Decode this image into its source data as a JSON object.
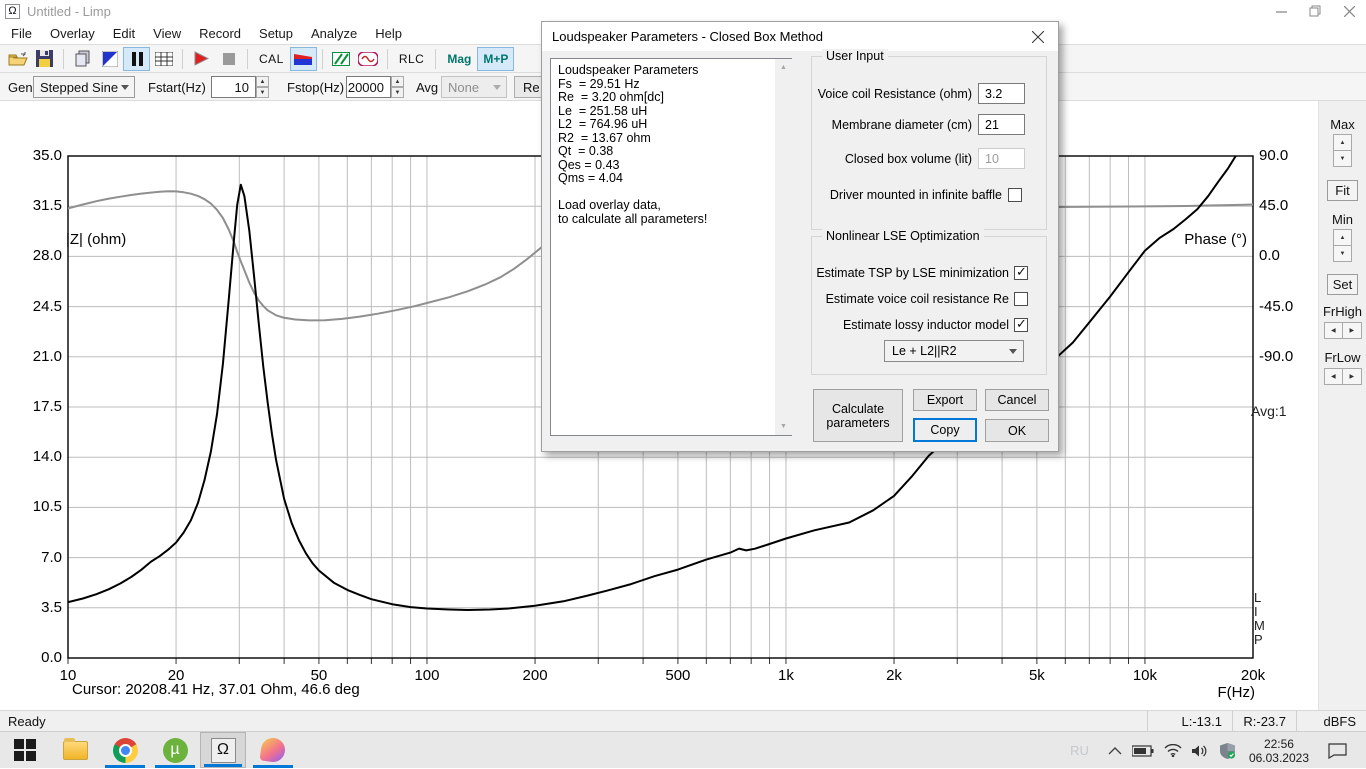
{
  "window": {
    "title": "Untitled - Limp",
    "icon": "Ω",
    "controls": {
      "minimize": "–",
      "restore": "❐",
      "close": "×"
    }
  },
  "menu": {
    "items": [
      "File",
      "Overlay",
      "Edit",
      "View",
      "Record",
      "Setup",
      "Analyze",
      "Help"
    ]
  },
  "toolbar": {
    "cal_label": "CAL",
    "rlc_label": "RLC",
    "mag_label": "Mag",
    "mp_label": "M+P"
  },
  "controls": {
    "gen_label": "Gen",
    "gen_value": "Stepped Sine",
    "fstart_label": "Fstart(Hz)",
    "fstart_value": "10",
    "fstop_label": "Fstop(Hz)",
    "fstop_value": "20000",
    "avg_label": "Avg",
    "avg_value": "None",
    "re_button_label": "Re"
  },
  "chart": {
    "left_title": "|Z| (ohm)",
    "right_title": "Phase (°)",
    "x_title": "F(Hz)",
    "cursor_text": "Cursor: 20208.41 Hz, 37.01 Ohm, 46.6 deg",
    "avg_badge": "Avg:1",
    "limp_vertical": [
      "L",
      "I",
      "M",
      "P"
    ]
  },
  "chart_data": {
    "type": "line",
    "title": "Impedance magnitude and phase vs frequency",
    "xlabel": "F(Hz)",
    "x_axis": {
      "scale": "log",
      "min": 10,
      "max": 20000,
      "ticks": [
        {
          "label": "10",
          "f": 10
        },
        {
          "label": "20",
          "f": 20
        },
        {
          "label": "50",
          "f": 50
        },
        {
          "label": "100",
          "f": 100
        },
        {
          "label": "200",
          "f": 200
        },
        {
          "label": "500",
          "f": 500
        },
        {
          "label": "1k",
          "f": 1000
        },
        {
          "label": "2k",
          "f": 2000
        },
        {
          "label": "5k",
          "f": 5000
        },
        {
          "label": "10k",
          "f": 10000
        },
        {
          "label": "20k",
          "f": 20000
        }
      ]
    },
    "y_left": {
      "label": "|Z| (ohm)",
      "min": 0,
      "max": 35,
      "ticks": [
        {
          "label": "35.0",
          "z": 35.0
        },
        {
          "label": "31.5",
          "z": 31.5
        },
        {
          "label": "28.0",
          "z": 28.0
        },
        {
          "label": "24.5",
          "z": 24.5
        },
        {
          "label": "21.0",
          "z": 21.0
        },
        {
          "label": "17.5",
          "z": 17.5
        },
        {
          "label": "14.0",
          "z": 14.0
        },
        {
          "label": "10.5",
          "z": 10.5
        },
        {
          "label": "7.0",
          "z": 7.0
        },
        {
          "label": "3.5",
          "z": 3.5
        },
        {
          "label": "0.0",
          "z": 0.0
        }
      ]
    },
    "y_right": {
      "label": "Phase (°)",
      "value_at_top": 90,
      "deg_per_division": 45,
      "ticks": [
        {
          "label": "90.0",
          "deg": 90
        },
        {
          "label": "45.0",
          "deg": 45
        },
        {
          "label": "0.0",
          "deg": 0
        },
        {
          "label": "-45.0",
          "deg": -45
        },
        {
          "label": "-90.0",
          "deg": -90
        }
      ]
    },
    "grid": true,
    "series": [
      {
        "name": "Phase",
        "axis": "right",
        "color": "#8f8f8f",
        "width": 2,
        "points": [
          [
            10,
            43
          ],
          [
            11,
            46.5
          ],
          [
            12,
            49.5
          ],
          [
            13,
            51.8
          ],
          [
            14,
            53.5
          ],
          [
            15,
            55
          ],
          [
            16,
            56.3
          ],
          [
            17,
            57.2
          ],
          [
            18,
            58
          ],
          [
            19,
            58.4
          ],
          [
            20,
            58.3
          ],
          [
            21,
            57.5
          ],
          [
            22,
            56.2
          ],
          [
            23,
            54.2
          ],
          [
            24,
            51.3
          ],
          [
            25,
            47.3
          ],
          [
            26,
            41.8
          ],
          [
            27,
            34.4
          ],
          [
            28,
            24.6
          ],
          [
            29,
            12.6
          ],
          [
            29.6,
            4
          ],
          [
            30.3,
            -4.5
          ],
          [
            31,
            -12.5
          ],
          [
            32,
            -23.5
          ],
          [
            33,
            -32.5
          ],
          [
            34,
            -39.5
          ],
          [
            35,
            -44.5
          ],
          [
            36,
            -48.3
          ],
          [
            38,
            -52.8
          ],
          [
            40,
            -55
          ],
          [
            43,
            -56.6
          ],
          [
            47,
            -57.4
          ],
          [
            52,
            -57.2
          ],
          [
            58,
            -56
          ],
          [
            65,
            -54
          ],
          [
            73,
            -51.4
          ],
          [
            82,
            -48.2
          ],
          [
            92,
            -44.7
          ],
          [
            100,
            -41.8
          ],
          [
            115,
            -36.7
          ],
          [
            130,
            -31.2
          ],
          [
            145,
            -25.3
          ],
          [
            160,
            -18.7
          ],
          [
            175,
            -11
          ],
          [
            190,
            -2.5
          ],
          [
            210,
            9
          ],
          [
            230,
            17.5
          ],
          [
            260,
            24.5
          ],
          [
            300,
            30
          ],
          [
            360,
            34.5
          ],
          [
            440,
            37.8
          ],
          [
            550,
            40.2
          ],
          [
            700,
            41.8
          ],
          [
            900,
            42.8
          ],
          [
            1200,
            43.4
          ],
          [
            1600,
            43.7
          ],
          [
            2200,
            43.9
          ],
          [
            3000,
            44
          ],
          [
            4000,
            44.2
          ],
          [
            5500,
            44.3
          ],
          [
            7000,
            44.5
          ],
          [
            9000,
            44.7
          ],
          [
            11000,
            44.9
          ],
          [
            13000,
            45.2
          ],
          [
            15000,
            45.6
          ],
          [
            17000,
            46
          ],
          [
            19000,
            46.3
          ],
          [
            20208,
            46.6
          ]
        ]
      },
      {
        "name": "Impedance |Z|",
        "axis": "left",
        "color": "#000000",
        "width": 2,
        "points": [
          [
            10,
            3.9
          ],
          [
            11,
            4.15
          ],
          [
            12,
            4.45
          ],
          [
            13,
            4.8
          ],
          [
            14,
            5.2
          ],
          [
            15,
            5.65
          ],
          [
            16,
            6.15
          ],
          [
            17,
            6.7
          ],
          [
            18,
            7.1
          ],
          [
            19,
            7.55
          ],
          [
            20,
            8.05
          ],
          [
            21,
            8.75
          ],
          [
            22,
            9.6
          ],
          [
            23,
            10.8
          ],
          [
            24,
            12.4
          ],
          [
            25,
            14.4
          ],
          [
            26,
            17
          ],
          [
            27,
            20.5
          ],
          [
            28,
            24.8
          ],
          [
            29,
            29.2
          ],
          [
            29.6,
            31.6
          ],
          [
            30.3,
            33
          ],
          [
            31,
            32.2
          ],
          [
            32,
            29.8
          ],
          [
            33,
            26.6
          ],
          [
            34,
            23.3
          ],
          [
            35,
            20.3
          ],
          [
            36,
            17.8
          ],
          [
            37,
            15.6
          ],
          [
            38,
            13.8
          ],
          [
            40,
            11.1
          ],
          [
            42,
            9.4
          ],
          [
            44,
            8.2
          ],
          [
            46,
            7.3
          ],
          [
            48,
            6.6
          ],
          [
            50,
            6.1
          ],
          [
            55,
            5.25
          ],
          [
            60,
            4.75
          ],
          [
            65,
            4.4
          ],
          [
            70,
            4.1
          ],
          [
            80,
            3.75
          ],
          [
            90,
            3.55
          ],
          [
            100,
            3.45
          ],
          [
            115,
            3.38
          ],
          [
            130,
            3.35
          ],
          [
            150,
            3.38
          ],
          [
            170,
            3.46
          ],
          [
            200,
            3.64
          ],
          [
            240,
            3.95
          ],
          [
            280,
            4.35
          ],
          [
            320,
            4.72
          ],
          [
            370,
            5.15
          ],
          [
            430,
            5.7
          ],
          [
            500,
            6.16
          ],
          [
            600,
            6.86
          ],
          [
            700,
            7.35
          ],
          [
            740,
            7.63
          ],
          [
            775,
            7.5
          ],
          [
            820,
            7.62
          ],
          [
            900,
            7.95
          ],
          [
            1000,
            8.33
          ],
          [
            1200,
            8.9
          ],
          [
            1500,
            9.45
          ],
          [
            1750,
            10.3
          ],
          [
            2000,
            11.3
          ],
          [
            2250,
            12.7
          ],
          [
            2500,
            14.1
          ],
          [
            3000,
            15.9
          ],
          [
            3500,
            17.4
          ],
          [
            4000,
            18.6
          ],
          [
            4500,
            19.7
          ],
          [
            5000,
            20.3
          ],
          [
            5700,
            21
          ],
          [
            6300,
            22
          ],
          [
            7000,
            23.4
          ],
          [
            8000,
            25.2
          ],
          [
            9000,
            26.9
          ],
          [
            10000,
            28.4
          ],
          [
            11000,
            29.3
          ],
          [
            12000,
            29.9
          ],
          [
            13000,
            30.6
          ],
          [
            14000,
            31.3
          ],
          [
            15000,
            32.2
          ],
          [
            16000,
            33.2
          ],
          [
            17000,
            34.1
          ],
          [
            18000,
            35.1
          ],
          [
            19000,
            36
          ],
          [
            20208,
            37.01
          ]
        ]
      }
    ],
    "annotations": {
      "cursor": "Cursor: 20208.41 Hz, 37.01 Ohm, 46.6 deg",
      "averages": "Avg:1"
    }
  },
  "side_panel": {
    "max_label": "Max",
    "fit_label": "Fit",
    "min_label": "Min",
    "set_label": "Set",
    "frhigh_label": "FrHigh",
    "frlow_label": "FrLow"
  },
  "dialog": {
    "title": "Loudspeaker Parameters - Closed Box Method",
    "close": "×",
    "results_text": "Loudspeaker Parameters\nFs  = 29.51 Hz\nRe  = 3.20 ohm[dc]\nLe  = 251.58 uH\nL2  = 764.96 uH\nR2  = 13.67 ohm\nQt  = 0.38\nQes = 0.43\nQms = 4.04\n\nLoad overlay data,\nto calculate all parameters!",
    "user_input": {
      "group_label": "User Input",
      "voice_coil_label": "Voice coil Resistance (ohm)",
      "voice_coil_value": "3.2",
      "membrane_label": "Membrane diameter (cm)",
      "membrane_value": "21",
      "box_volume_label": "Closed box volume (lit)",
      "box_volume_value": "10",
      "baffle_label": "Driver mounted in infinite baffle",
      "baffle_checked": false
    },
    "lse": {
      "group_label": "Nonlinear LSE Optimization",
      "tsp_label": "Estimate TSP by LSE minimization",
      "tsp_checked": true,
      "re_label": "Estimate voice coil resistance Re",
      "re_checked": false,
      "lossy_label": "Estimate lossy inductor model",
      "lossy_checked": true,
      "model_value": "Le + L2||R2"
    },
    "buttons": {
      "calculate": "Calculate parameters",
      "export": "Export",
      "cancel": "Cancel",
      "copy": "Copy",
      "ok": "OK"
    }
  },
  "status_bar": {
    "ready": "Ready",
    "left_level": "L:-13.1",
    "right_level": "R:-23.7",
    "unit": "dBFS"
  },
  "taskbar": {
    "language": "RU",
    "time": "22:56",
    "date": "06.03.2023",
    "accent": "#0078d7"
  },
  "colors": {
    "accent": "#0078d7",
    "impedance": "#000000",
    "phase": "#8f8f8f",
    "grid": "#bdbdbd",
    "toolbar_active_bg": "#d6e9f9",
    "teal_text": "#00766e"
  }
}
